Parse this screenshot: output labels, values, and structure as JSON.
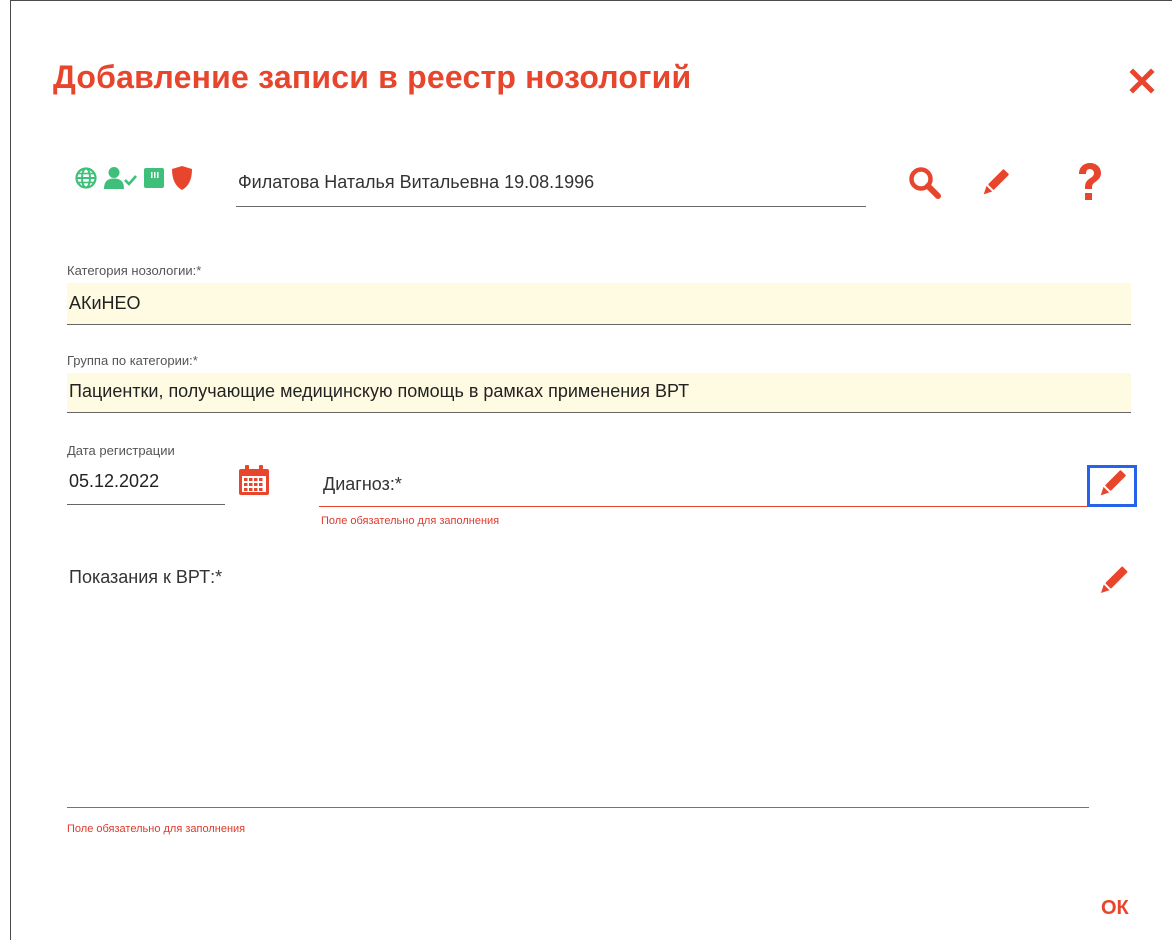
{
  "dialog": {
    "title": "Добавление записи в реестр нозологий",
    "close_icon": "close-icon"
  },
  "patient": {
    "status_icons": [
      "globe-icon",
      "user-check-icon",
      "card-icon",
      "shield-icon"
    ],
    "name": "Филатова Наталья Витальевна 19.08.1996",
    "actions": [
      "search-icon",
      "pencil-icon",
      "help-icon"
    ]
  },
  "category": {
    "label": "Категория нозологии:*",
    "value": "АКиНЕО"
  },
  "group": {
    "label": "Группа по категории:*",
    "value": "Пациентки, получающие медицинскую помощь в рамках применения ВРТ"
  },
  "registration_date": {
    "label": "Дата регистрации",
    "value": "05.12.2022"
  },
  "diagnosis": {
    "label": "Диагноз:*",
    "error": "Поле обязательно для заполнения"
  },
  "indications": {
    "label": "Показания к ВРТ:*",
    "error": "Поле обязательно для заполнения"
  },
  "ok_label": "ОК",
  "colors": {
    "accent": "#e8452d",
    "green": "#3ec07a",
    "highlight": "#fffbe3",
    "focus": "#2563eb"
  }
}
